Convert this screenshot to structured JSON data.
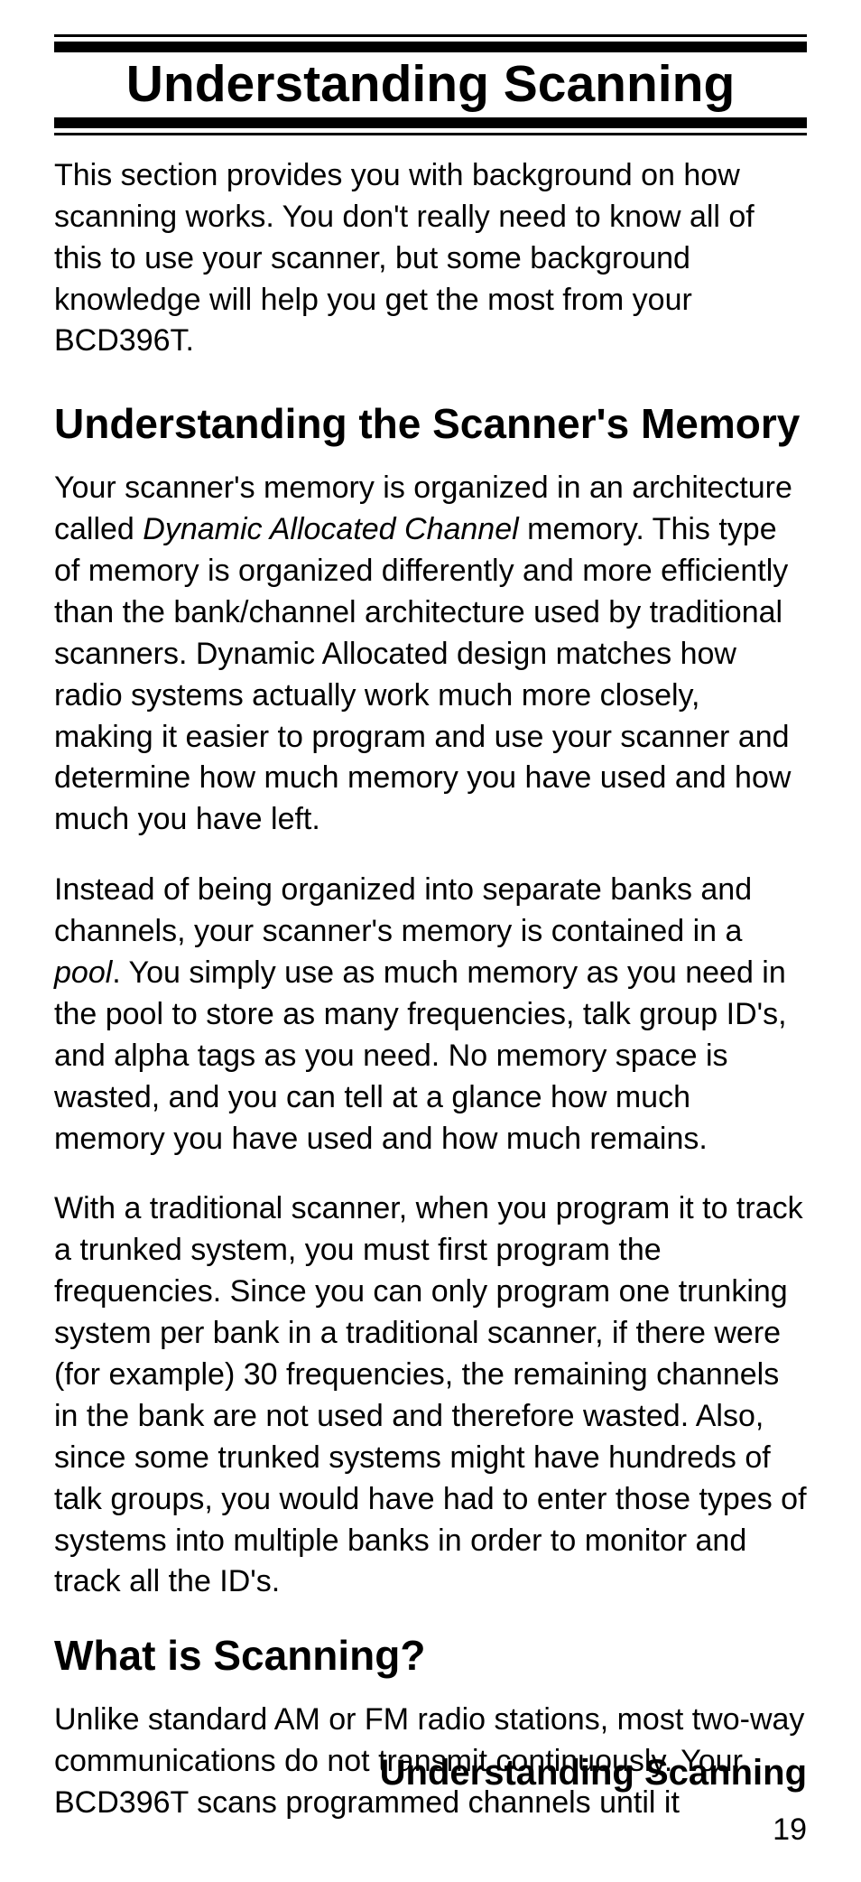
{
  "title": "Understanding Scanning",
  "intro": "This section provides you with background on how scanning works. You don't really need to know all of this to use your scanner, but some background knowledge will help you get the most from your BCD396T.",
  "section1": {
    "heading": "Understanding the Scanner's Memory",
    "p1_a": "Your scanner's memory is organized in an architecture called ",
    "p1_b_italic": "Dynamic Allocated Channel",
    "p1_c": " memory. This type of memory is organized differently and more efficiently than the bank/channel architecture used by traditional scanners. Dynamic Allocated design matches how radio systems actually work much more closely, making it easier to program and use your scanner and deter­mine how much memory you have used and how much you have left.",
    "p2_a": "Instead of being organized into separate banks and channels, your scanner's memory is contained in a ",
    "p2_b_italic": "pool",
    "p2_c": ". You simply use as much memory as you need in the pool to store as many frequencies, talk group ID's, and alpha tags as you need. No memory space is wasted, and you can tell at a glance how much memory you have used and how much remains.",
    "p3": "With a traditional scanner, when you program it to track a trunked system, you must first program the frequencies. Since you can only program one trunking system per bank in a traditional scanner, if there were (for example) 30 frequencies, the remaining channels in the bank are not used and therefore wasted. Also, since some trunked systems might have hundreds of talk groups, you would have had to enter those types of systems into multiple banks in order to monitor and track all the ID's."
  },
  "section2": {
    "heading": "What is Scanning?",
    "p1": "Unlike standard AM or FM radio stations, most two-way communications do not transmit continuously. Your BCD396T scans programmed channels until it"
  },
  "footer": {
    "running_title": "Understanding Scanning",
    "page_number": "19"
  }
}
